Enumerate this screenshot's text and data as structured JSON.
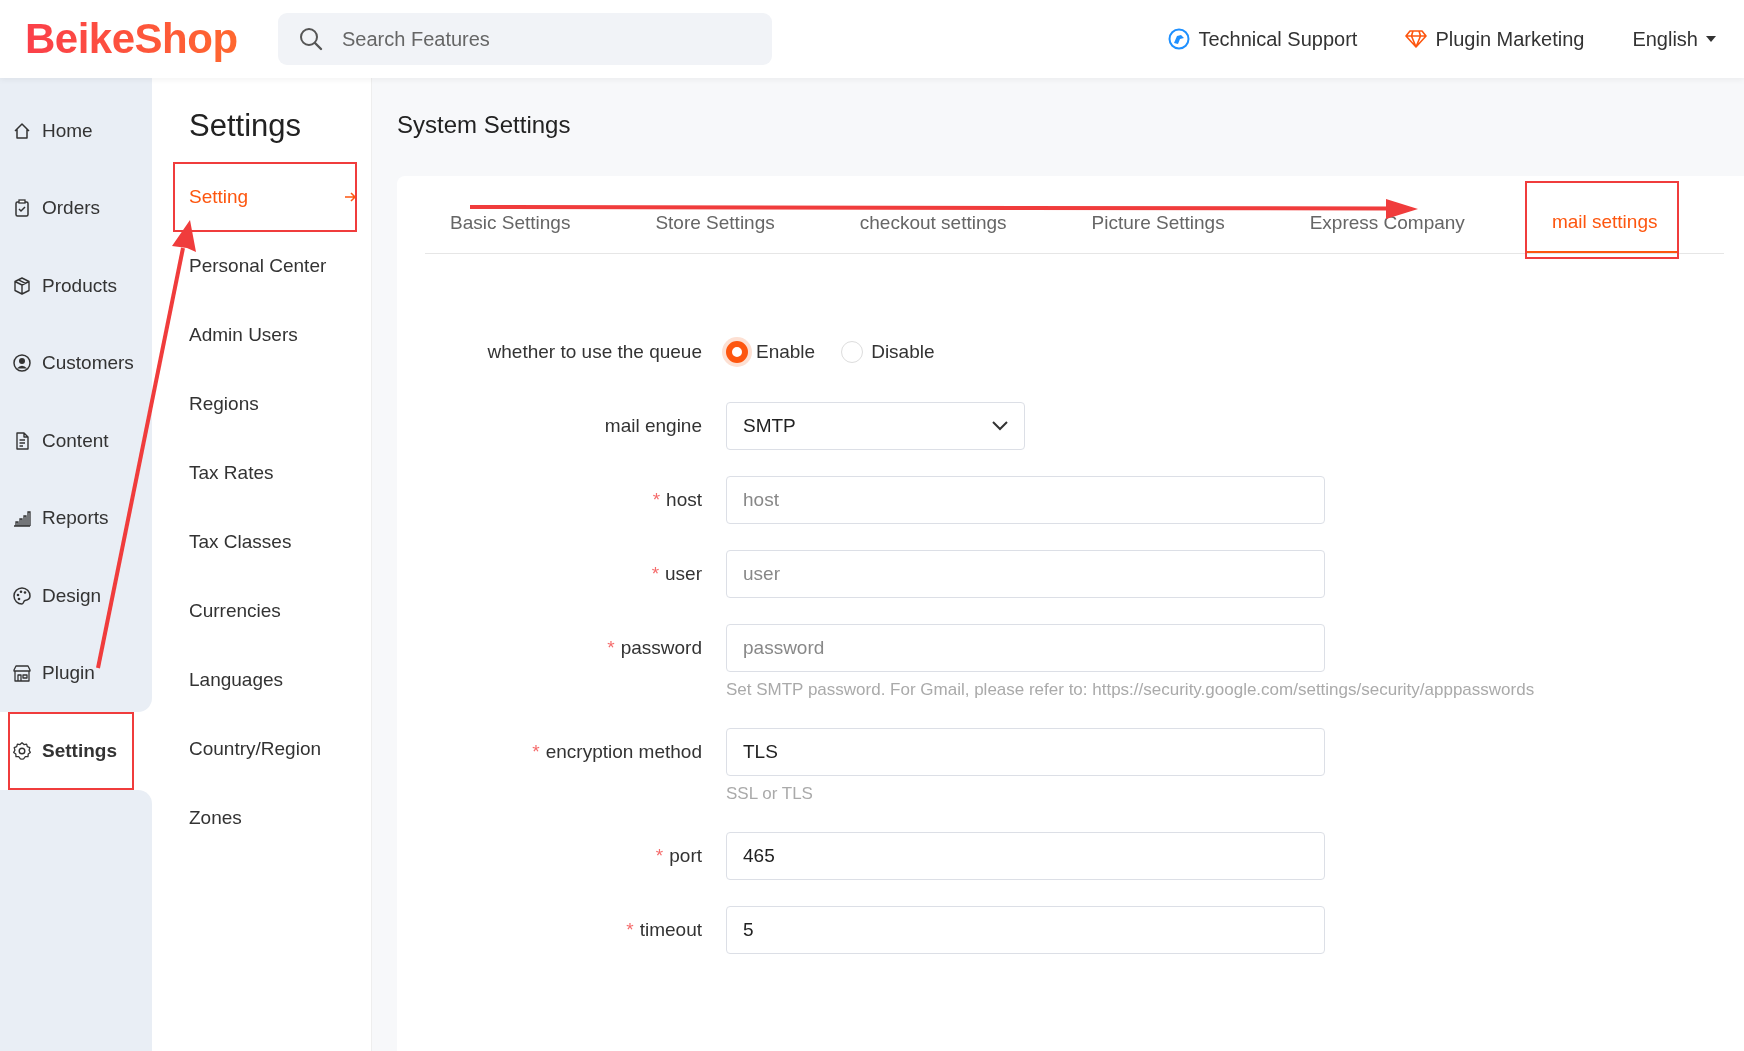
{
  "header": {
    "logo": "BeikeShop",
    "search": {
      "placeholder": "Search Features"
    },
    "links": [
      "Technical Support",
      "Plugin Marketing"
    ],
    "language": "English"
  },
  "sidebar": {
    "items": [
      {
        "label": "Home",
        "selected": false,
        "highlighted": false
      },
      {
        "label": "Orders",
        "selected": false,
        "highlighted": false
      },
      {
        "label": "Products",
        "selected": false,
        "highlighted": false
      },
      {
        "label": "Customers",
        "selected": false,
        "highlighted": false
      },
      {
        "label": "Content",
        "selected": false,
        "highlighted": false
      },
      {
        "label": "Reports",
        "selected": false,
        "highlighted": false
      },
      {
        "label": "Design",
        "selected": false,
        "highlighted": false
      },
      {
        "label": "Plugin",
        "selected": false,
        "highlighted": false
      },
      {
        "label": "Settings",
        "selected": true,
        "highlighted": true
      }
    ]
  },
  "submenu": {
    "title": "Settings",
    "items": [
      {
        "label": "Setting",
        "selected": true,
        "highlighted": true
      },
      {
        "label": "Personal Center",
        "selected": false,
        "highlighted": false
      },
      {
        "label": "Admin Users",
        "selected": false,
        "highlighted": false
      },
      {
        "label": "Regions",
        "selected": false,
        "highlighted": false
      },
      {
        "label": "Tax Rates",
        "selected": false,
        "highlighted": false
      },
      {
        "label": "Tax Classes",
        "selected": false,
        "highlighted": false
      },
      {
        "label": "Currencies",
        "selected": false,
        "highlighted": false
      },
      {
        "label": "Languages",
        "selected": false,
        "highlighted": false
      },
      {
        "label": "Country/Region",
        "selected": false,
        "highlighted": false
      },
      {
        "label": "Zones",
        "selected": false,
        "highlighted": false
      }
    ]
  },
  "main": {
    "title": "System Settings",
    "tabs": [
      {
        "label": "Basic Settings",
        "selected": false,
        "highlighted": false
      },
      {
        "label": "Store Settings",
        "selected": false,
        "highlighted": false
      },
      {
        "label": "checkout settings",
        "selected": false,
        "highlighted": false
      },
      {
        "label": "Picture Settings",
        "selected": false,
        "highlighted": false
      },
      {
        "label": "Express Company",
        "selected": false,
        "highlighted": false
      },
      {
        "label": "mail settings",
        "selected": true,
        "highlighted": true
      }
    ],
    "form": [
      {
        "kind": "radio",
        "label": "whether to use the queue",
        "options": [
          {
            "label": "Enable",
            "selected": true
          },
          {
            "label": "Disable",
            "selected": false
          }
        ]
      },
      {
        "kind": "select",
        "label": "mail engine",
        "value": "SMTP"
      },
      {
        "kind": "input",
        "label": "host",
        "required_mark": "*",
        "placeholder": "host"
      },
      {
        "kind": "input",
        "label": "user",
        "required_mark": "*",
        "placeholder": "user"
      },
      {
        "kind": "input",
        "label": "password",
        "required_mark": "*",
        "placeholder": "password",
        "help": "Set SMTP password. For Gmail, please refer to: https://security.google.com/settings/security/apppasswords"
      },
      {
        "kind": "input",
        "label": "encryption method",
        "required_mark": "*",
        "value": "TLS",
        "help": "SSL or TLS"
      },
      {
        "kind": "input",
        "label": "port",
        "required_mark": "*",
        "value": "465"
      },
      {
        "kind": "input",
        "label": "timeout",
        "required_mark": "*",
        "value": "5"
      }
    ]
  }
}
